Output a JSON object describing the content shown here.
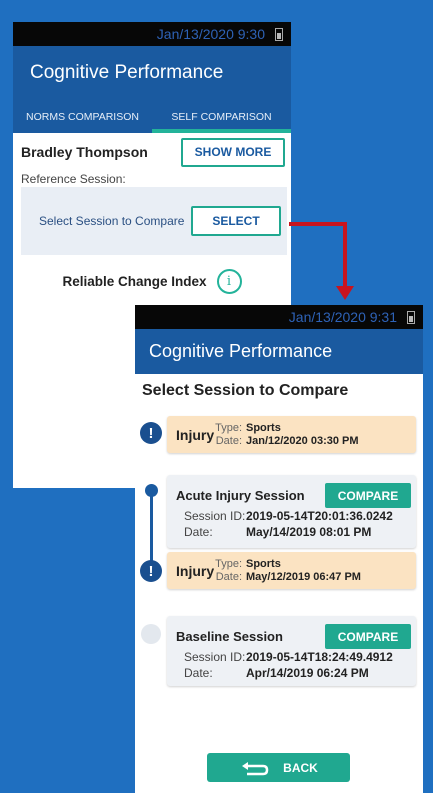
{
  "screen1": {
    "status_time": "Jan/13/2020 9:30",
    "app_title": "Cognitive Performance",
    "tabs": [
      "NORMS COMPARISON",
      "SELF COMPARISON"
    ],
    "user_name": "Bradley Thompson",
    "show_more_label": "SHOW MORE",
    "reference_label": "Reference Session:",
    "select_prompt": "Select Session to Compare",
    "select_label": "SELECT",
    "rci_label": "Reliable Change Index",
    "info_glyph": "i"
  },
  "screen2": {
    "status_time": "Jan/13/2020 9:31",
    "app_title": "Cognitive Performance",
    "section_title": "Select Session to Compare",
    "injury1": {
      "label": "Injury",
      "type_key": "Type:",
      "type": "Sports",
      "date_key": "Date:",
      "date": "Jan/12/2020 03:30 PM"
    },
    "acute": {
      "name": "Acute Injury Session",
      "compare": "COMPARE",
      "id_key": "Session ID:",
      "id": "2019-05-14T20:01:36.0242",
      "date_key": "Date:",
      "date": "May/14/2019 08:01 PM"
    },
    "injury2": {
      "label": "Injury",
      "type_key": "Type:",
      "type": "Sports",
      "date_key": "Date:",
      "date": "May/12/2019 06:47 PM"
    },
    "baseline": {
      "name": "Baseline Session",
      "compare": "COMPARE",
      "id_key": "Session ID:",
      "id": "2019-05-14T18:24:49.4912",
      "date_key": "Date:",
      "date": "Apr/14/2019 06:24 PM"
    },
    "back_label": "BACK"
  },
  "colors": {
    "background": "#1f6fc0",
    "app_bar": "#1a5aa0",
    "accent": "#20a890",
    "injury_card": "#fbe3c2",
    "connector": "#c8141e"
  },
  "icons": [
    "battery-icon",
    "info-icon",
    "exclamation-icon",
    "back-arrow-icon",
    "arrow-down-icon"
  ]
}
